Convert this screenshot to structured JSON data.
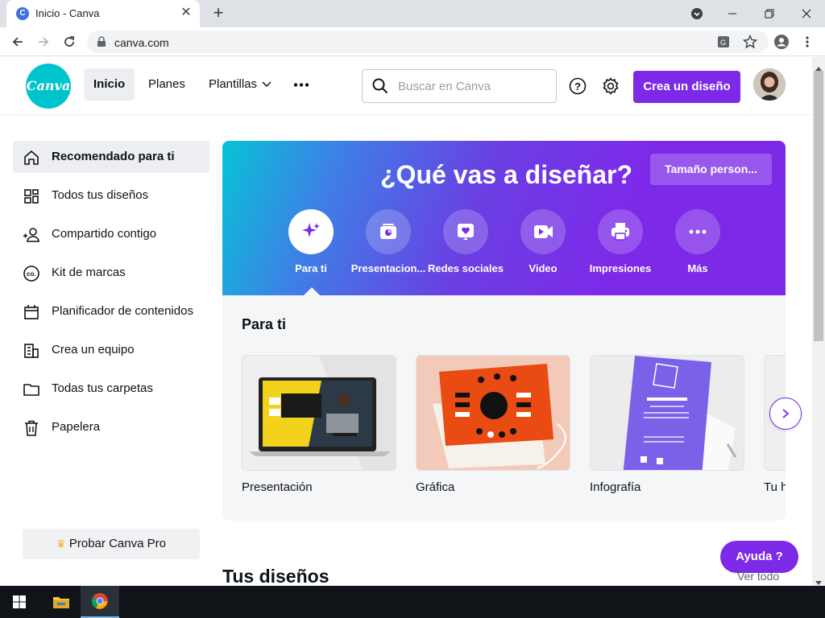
{
  "browser": {
    "tab_title": "Inicio - Canva",
    "favicon_letter": "C",
    "url": "canva.com"
  },
  "header": {
    "logo_text": "Canva",
    "nav": {
      "home": "Inicio",
      "plans": "Planes",
      "templates": "Plantillas"
    },
    "search_placeholder": "Buscar en Canva",
    "create_button": "Crea un diseño",
    "accent_color": "#7d2ae8"
  },
  "sidebar": {
    "items": [
      {
        "label": "Recomendado para ti",
        "icon": "home-icon",
        "active": true
      },
      {
        "label": "Todos tus diseños",
        "icon": "grid-icon"
      },
      {
        "label": "Compartido contigo",
        "icon": "shared-users-icon"
      },
      {
        "label": "Kit de marcas",
        "icon": "brand-kit-icon"
      },
      {
        "label": "Planificador de contenidos",
        "icon": "calendar-icon"
      },
      {
        "label": "Crea un equipo",
        "icon": "building-icon"
      },
      {
        "label": "Todas tus carpetas",
        "icon": "folder-icon"
      },
      {
        "label": "Papelera",
        "icon": "trash-icon"
      }
    ],
    "pro_button": "Probar Canva Pro"
  },
  "banner": {
    "title": "¿Qué vas a diseñar?",
    "custom_size_button": "Tamaño person...",
    "categories": [
      {
        "label": "Para ti",
        "icon": "sparkle-icon"
      },
      {
        "label": "Presentacion...",
        "icon": "presentation-icon"
      },
      {
        "label": "Redes sociales",
        "icon": "heart-icon"
      },
      {
        "label": "Video",
        "icon": "video-icon"
      },
      {
        "label": "Impresiones",
        "icon": "printer-icon"
      },
      {
        "label": "Más",
        "icon": "more-icon"
      }
    ]
  },
  "for_you": {
    "title": "Para ti",
    "cards": [
      {
        "label": "Presentación"
      },
      {
        "label": "Gráfica"
      },
      {
        "label": "Infografía"
      },
      {
        "label": "Tu h"
      }
    ]
  },
  "designs_section": {
    "title": "Tus diseños",
    "see_all": "Ver todo"
  },
  "help_button": "Ayuda  ?"
}
